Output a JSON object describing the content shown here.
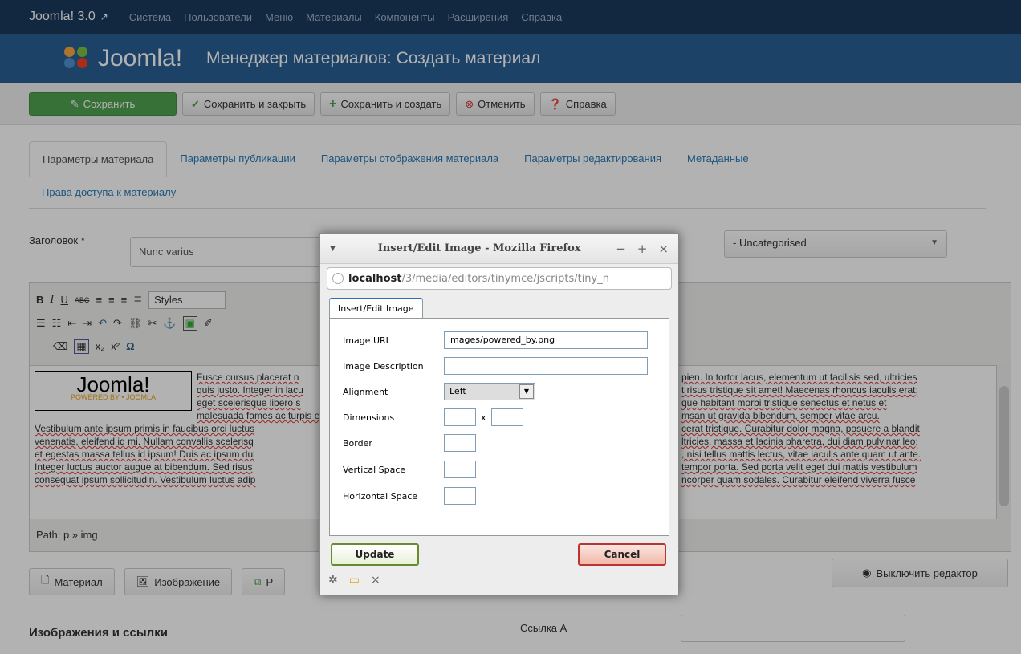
{
  "topbar": {
    "brand": "Joomla! 3.0",
    "brand_icon": "external-link-icon",
    "menu": [
      "Система",
      "Пользователи",
      "Меню",
      "Материалы",
      "Компоненты",
      "Расширения",
      "Справка"
    ]
  },
  "header": {
    "logo_text": "Joomla!",
    "title": "Менеджер материалов: Создать материал"
  },
  "toolbar": {
    "save": "Сохранить",
    "save_close": "Сохранить и закрыть",
    "save_new": "Сохранить и создать",
    "cancel": "Отменить",
    "help": "Справка"
  },
  "tabs": {
    "items": [
      "Параметры материала",
      "Параметры публикации",
      "Параметры отображения материала",
      "Параметры редактирования",
      "Метаданные"
    ],
    "row2": "Права доступа к материалу"
  },
  "form": {
    "title_label": "Заголовок *",
    "title_value": "Nunc varius",
    "category_value": "- Uncategorised"
  },
  "editor": {
    "styles_label": "Styles",
    "image_text": "Joomla!",
    "image_sub": "POWERED BY • JOOMLA",
    "left_lines": [
      "Fusce cursus placerat n",
      "quis justo. Integer in lacu",
      "eget scelerisque libero s",
      "malesuada fames ac turpis egestas. Curabitur at urn",
      "Vestibulum ante ipsum primis in faucibus orci luctus",
      "venenatis, eleifend id mi. Nullam convallis scelerisq",
      "et egestas massa tellus id ipsum! Duis ac ipsum dui",
      "Integer luctus auctor augue at bibendum. Sed risus",
      "consequat ipsum sollicitudin. Vestibulum luctus adip"
    ],
    "right_lines": [
      "pien. In tortor lacus, elementum ut facilisis sed, ultricies",
      "t risus tristique sit amet! Maecenas rhoncus iaculis erat;",
      "que habitant morbi tristique senectus et netus et",
      "msan ut gravida bibendum, semper vitae arcu.",
      "cerat tristique. Curabitur dolor magna, posuere a blandit",
      "ltricies, massa et lacinia pharetra, dui diam pulvinar leo;",
      ", nisi tellus mattis lectus, vitae iaculis ante quam ut ante.",
      " tempor porta. Sed porta velit eget dui mattis vestibulum",
      "ncorper quam sodales. Curabitur eleifend viverra fusce"
    ],
    "path": "Path: p » img"
  },
  "bottom": {
    "article_btn": "Материал",
    "image_btn": "Изображение",
    "readmore_btn": "Р",
    "toggle_editor": "Выключить редактор",
    "section_title": "Изображения и ссылки",
    "link_label": "Ссылка A"
  },
  "popup": {
    "window_title": "Insert/Edit Image - Mozilla Firefox",
    "url_host": "localhost",
    "url_path": "/3/media/editors/tinymce/jscripts/tiny_n",
    "tab": "Insert/Edit Image",
    "labels": {
      "url": "Image URL",
      "description": "Image Description",
      "alignment": "Alignment",
      "dimensions": "Dimensions",
      "border": "Border",
      "vspace": "Vertical Space",
      "hspace": "Horizontal Space"
    },
    "values": {
      "url": "images/powered_by.png",
      "description": "",
      "alignment": "Left",
      "dim_sep": "x"
    },
    "update": "Update",
    "cancel": "Cancel"
  }
}
